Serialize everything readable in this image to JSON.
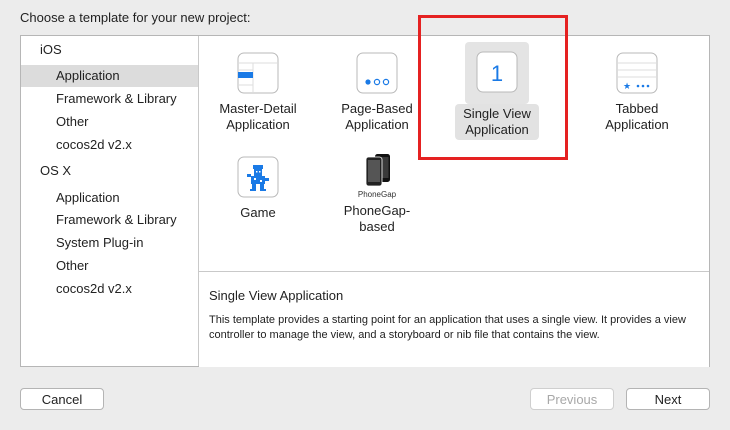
{
  "prompt": "Choose a template for your new project:",
  "sidebar": {
    "ios_header": "iOS",
    "ios_items": [
      "Application",
      "Framework & Library",
      "Other",
      "cocos2d v2.x"
    ],
    "osx_header": "OS X",
    "osx_items": [
      "Application",
      "Framework & Library",
      "System Plug-in",
      "Other",
      "cocos2d v2.x"
    ]
  },
  "templates": [
    {
      "label": "Master-Detail\nApplication",
      "icon": "master-detail-icon"
    },
    {
      "label": "Page-Based\nApplication",
      "icon": "page-based-icon"
    },
    {
      "label": "Single View\nApplication",
      "icon": "single-view-icon",
      "glyph": "1"
    },
    {
      "label": "Tabbed\nApplication",
      "icon": "tabbed-icon"
    },
    {
      "label": "Game",
      "icon": "game-icon"
    },
    {
      "label": "PhoneGap-\nbased",
      "icon": "phonegap-icon",
      "brand": "PhoneGap"
    }
  ],
  "description": {
    "title": "Single View Application",
    "body": "This template provides a starting point for an application that uses a single view. It provides a view controller to manage the view, and a storyboard or nib file that contains the view."
  },
  "buttons": {
    "cancel": "Cancel",
    "previous": "Previous",
    "next": "Next"
  },
  "colors": {
    "highlight": "#e52121",
    "accent": "#1a7ae6",
    "selection": "#dcdcdc"
  }
}
